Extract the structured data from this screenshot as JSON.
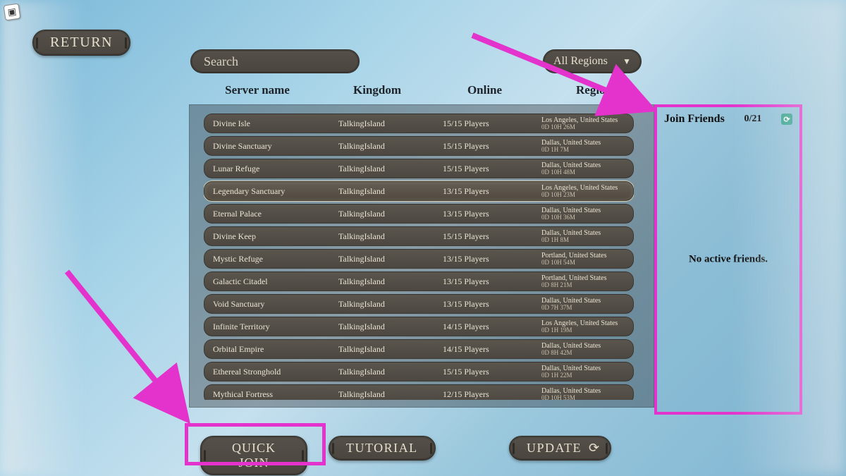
{
  "roblox_icon_label": "⬜",
  "return_label": "RETURN",
  "search": {
    "placeholder": "Search"
  },
  "region_filter": {
    "label": "All Regions"
  },
  "columns": {
    "name": "Server name",
    "kingdom": "Kingdom",
    "online": "Online",
    "region": "Region"
  },
  "servers": [
    {
      "name": "Divine Isle",
      "kingdom": "TalkingIsland",
      "online": "15/15 Players",
      "region": "Los Angeles, United States",
      "age": "0D 10H 26M",
      "selected": false
    },
    {
      "name": "Divine Sanctuary",
      "kingdom": "TalkingIsland",
      "online": "15/15 Players",
      "region": "Dallas, United States",
      "age": "0D 1H 7M",
      "selected": false
    },
    {
      "name": "Lunar Refuge",
      "kingdom": "TalkingIsland",
      "online": "15/15 Players",
      "region": "Dallas, United States",
      "age": "0D 10H 48M",
      "selected": false
    },
    {
      "name": "Legendary Sanctuary",
      "kingdom": "TalkingIsland",
      "online": "13/15 Players",
      "region": "Los Angeles, United States",
      "age": "0D 10H 23M",
      "selected": true
    },
    {
      "name": "Eternal Palace",
      "kingdom": "TalkingIsland",
      "online": "13/15 Players",
      "region": "Dallas, United States",
      "age": "0D 10H 36M",
      "selected": false
    },
    {
      "name": "Divine Keep",
      "kingdom": "TalkingIsland",
      "online": "15/15 Players",
      "region": "Dallas, United States",
      "age": "0D 1H 8M",
      "selected": false
    },
    {
      "name": "Mystic Refuge",
      "kingdom": "TalkingIsland",
      "online": "13/15 Players",
      "region": "Portland, United States",
      "age": "0D 10H 54M",
      "selected": false
    },
    {
      "name": "Galactic Citadel",
      "kingdom": "TalkingIsland",
      "online": "13/15 Players",
      "region": "Portland, United States",
      "age": "0D 8H 21M",
      "selected": false
    },
    {
      "name": "Void Sanctuary",
      "kingdom": "TalkingIsland",
      "online": "13/15 Players",
      "region": "Dallas, United States",
      "age": "0D 7H 37M",
      "selected": false
    },
    {
      "name": "Infinite Territory",
      "kingdom": "TalkingIsland",
      "online": "14/15 Players",
      "region": "Los Angeles, United States",
      "age": "0D 1H 19M",
      "selected": false
    },
    {
      "name": "Orbital Empire",
      "kingdom": "TalkingIsland",
      "online": "14/15 Players",
      "region": "Dallas, United States",
      "age": "0D 8H 42M",
      "selected": false
    },
    {
      "name": "Ethereal Stronghold",
      "kingdom": "TalkingIsland",
      "online": "15/15 Players",
      "region": "Dallas, United States",
      "age": "0D 1H 22M",
      "selected": false
    },
    {
      "name": "Mythical Fortress",
      "kingdom": "TalkingIsland",
      "online": "12/15 Players",
      "region": "Dallas, United States",
      "age": "0D 10H 53M",
      "selected": false
    }
  ],
  "friends": {
    "title": "Join Friends",
    "count": "0/21",
    "empty": "No active friends."
  },
  "buttons": {
    "quick_join": "QUICK JOIN",
    "tutorial": "TUTORIAL",
    "update": "UPDATE"
  },
  "annotation_color": "#e333cc"
}
